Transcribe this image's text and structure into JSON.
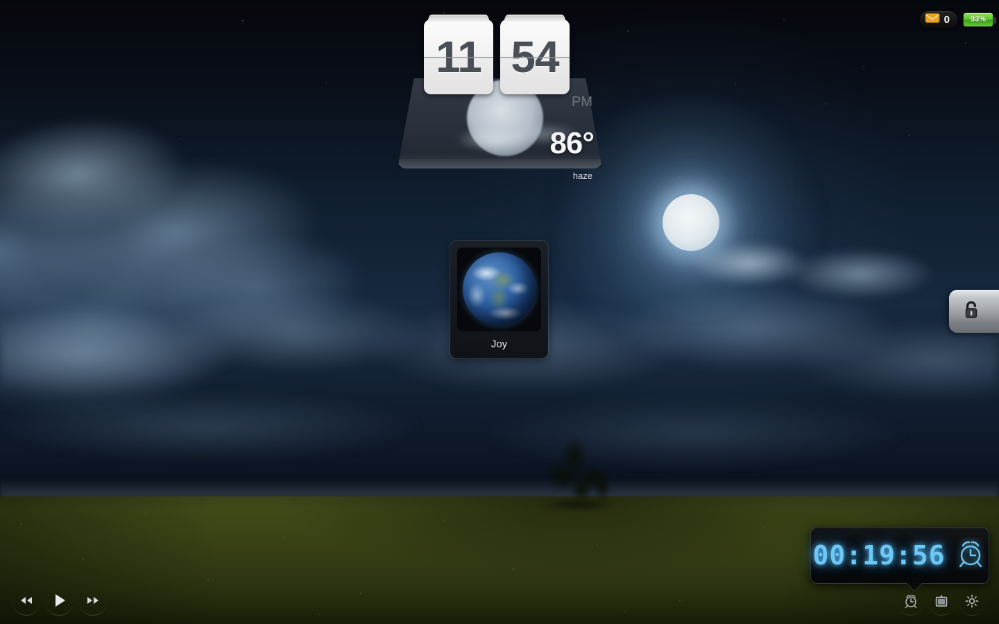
{
  "status": {
    "mail": {
      "icon": "envelope-icon",
      "count": "0"
    },
    "battery": {
      "icon": "battery-icon",
      "level": "93%",
      "color": "#5fc52e"
    }
  },
  "clock_widget": {
    "hours": "11",
    "minutes": "54",
    "meridiem": "PM",
    "temperature": "86°",
    "condition": "haze",
    "weather_icon": "hazy-moon-icon"
  },
  "app_icon": {
    "label": "Joy",
    "icon": "earth-globe-icon"
  },
  "lock_tab": {
    "icon": "padlock-icon"
  },
  "timer": {
    "display": "00:19:56",
    "icon": "alarm-clock-icon",
    "digit_color": "#6ec8f5"
  },
  "media_controls": [
    {
      "name": "previous-button",
      "icon": "rewind-icon"
    },
    {
      "name": "play-button",
      "icon": "play-icon"
    },
    {
      "name": "next-button",
      "icon": "fast-forward-icon"
    }
  ],
  "tray_buttons": [
    {
      "name": "alarm-button",
      "icon": "alarm-clock-icon"
    },
    {
      "name": "slideshow-button",
      "icon": "picture-frame-icon"
    },
    {
      "name": "brightness-button",
      "icon": "brightness-icon"
    }
  ],
  "wallpaper": {
    "scene": "night-sky-moon-over-field",
    "sky_color": "#122235",
    "field_color": "#3a4318"
  }
}
